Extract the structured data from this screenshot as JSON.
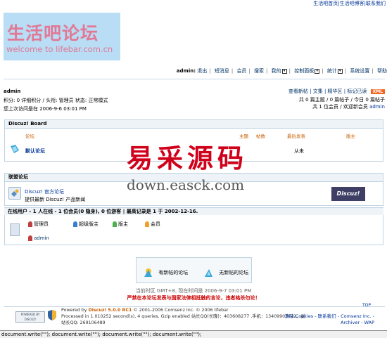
{
  "top_links": "生活吧首页|生活吧博客|联系我们",
  "logo": {
    "cn": "生活吧论坛",
    "en": "welcome to lifebar.com.cn"
  },
  "nav": {
    "user": "admin:",
    "logout": "退出",
    "pm": "短消息",
    "members": "会员",
    "search": "搜索",
    "mine": "我的",
    "control": "控制面板",
    "stats": "统计",
    "settings": "系统设置",
    "help": "帮助"
  },
  "user": {
    "name": "admin",
    "line2": "积分: 0 详细积分 / 头衔: 管理员 状态: 正常模式",
    "line3": "您上次访问是在 2006-9-6 03:01 PM"
  },
  "right_links": {
    "new_posts": "查看新帖",
    "digest": "文集",
    "elite": "精华区",
    "mark_read": "标记已读",
    "xml": "XML"
  },
  "stats": {
    "line1": "共 0 篇主题 / 0 篇帖子 / 今日 0 篇帖子",
    "line2_prefix": "共 1 位会员 / 欢迎新会员",
    "newest": "admin"
  },
  "board": {
    "title": "Discuz! Board",
    "col_forum": "论坛",
    "col_topics": "主题",
    "col_posts": "帖数",
    "col_last": "最后发表",
    "col_mod": "版主",
    "forum_name": "默认论坛",
    "forum_last": "从未"
  },
  "links": {
    "title": "联盟论坛",
    "name": "Discuz! 官方论坛",
    "desc": "提供最新 Discuz! 产品新闻",
    "badge": "Discuz!"
  },
  "online": {
    "summary": "在线用户 - 1 人在线 - 1 位会员(0 隐身), 0 位游客 | 最高记录是 1 于 2002-12-16.",
    "groups": [
      "管理员",
      "超级版主",
      "版主",
      "会员",
      "admin"
    ]
  },
  "legend": {
    "new": "有新帖的论坛",
    "nonew": "无新帖的论坛"
  },
  "footer": {
    "timeline": "当前时区 GMT+8, 现在时间是 2006-9-7 03:01 PM",
    "warn": "严禁在本论坛发表与国家法律相抵触的言论，违者格杀勿论！",
    "top": "TOP",
    "powered": "Powered by",
    "discuz": "Discuz!",
    "version": "5.0.0 RC1",
    "copy": "© 2001-2006 Comsenz Inc. © 2006 lifebar",
    "processed": "Processed in 1.010252 second(s), 4 queries, Gzip enabled 站长QQ(长隆)：403608277 ,手机：13409903422。副",
    "qq": "站长QQ: 269106489",
    "right1": "清除 Cookies - 联系我们 - Comsenz Inc. -",
    "right2": "Archiver - WAP",
    "logo_text": "POWERED BY DISCUZ!"
  },
  "bottom_status": "document.write(\"\"); document.write(\"\"); document.write(\"\"); document.write(\"\");",
  "watermark": {
    "cn": "易采源码",
    "en": "down.easck.com"
  },
  "colors": {
    "brand_pink": "#e27896",
    "logo_bg": "#b8ddf4",
    "warn_red": "#cc0000",
    "accent_orange": "#f26522"
  }
}
